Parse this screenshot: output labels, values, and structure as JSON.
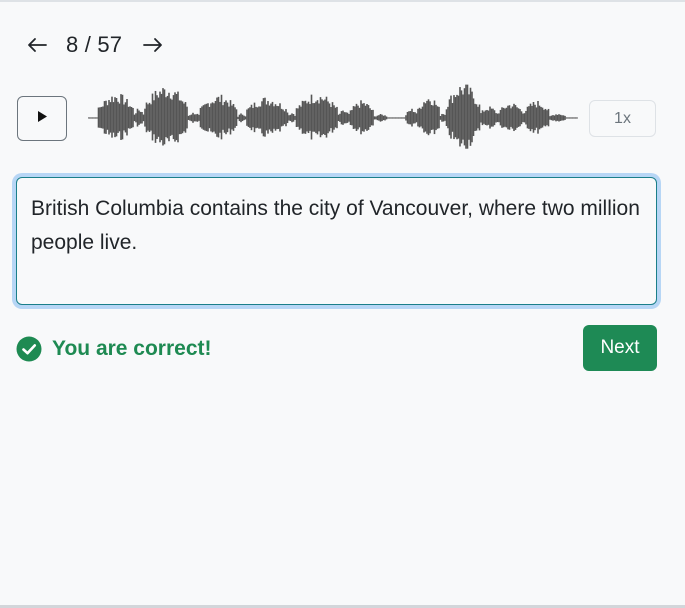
{
  "navigation": {
    "prev_icon": "arrow-left-icon",
    "next_icon": "arrow-right-icon",
    "current": 8,
    "total": 57,
    "counter_text": "8 / 57"
  },
  "player": {
    "play_icon": "play-icon",
    "speed_label": "1x"
  },
  "answer": {
    "text": "British Columbia contains the city of Vancouver, where two million people live."
  },
  "feedback": {
    "icon": "check-circle-icon",
    "message": "You are correct!",
    "color": "#1e8a52"
  },
  "actions": {
    "next_label": "Next",
    "next_color": "#1e8a55"
  },
  "colors": {
    "waveform": "#555555",
    "focus_ring": "#b7d6f5",
    "border": "#1a7f8a"
  }
}
